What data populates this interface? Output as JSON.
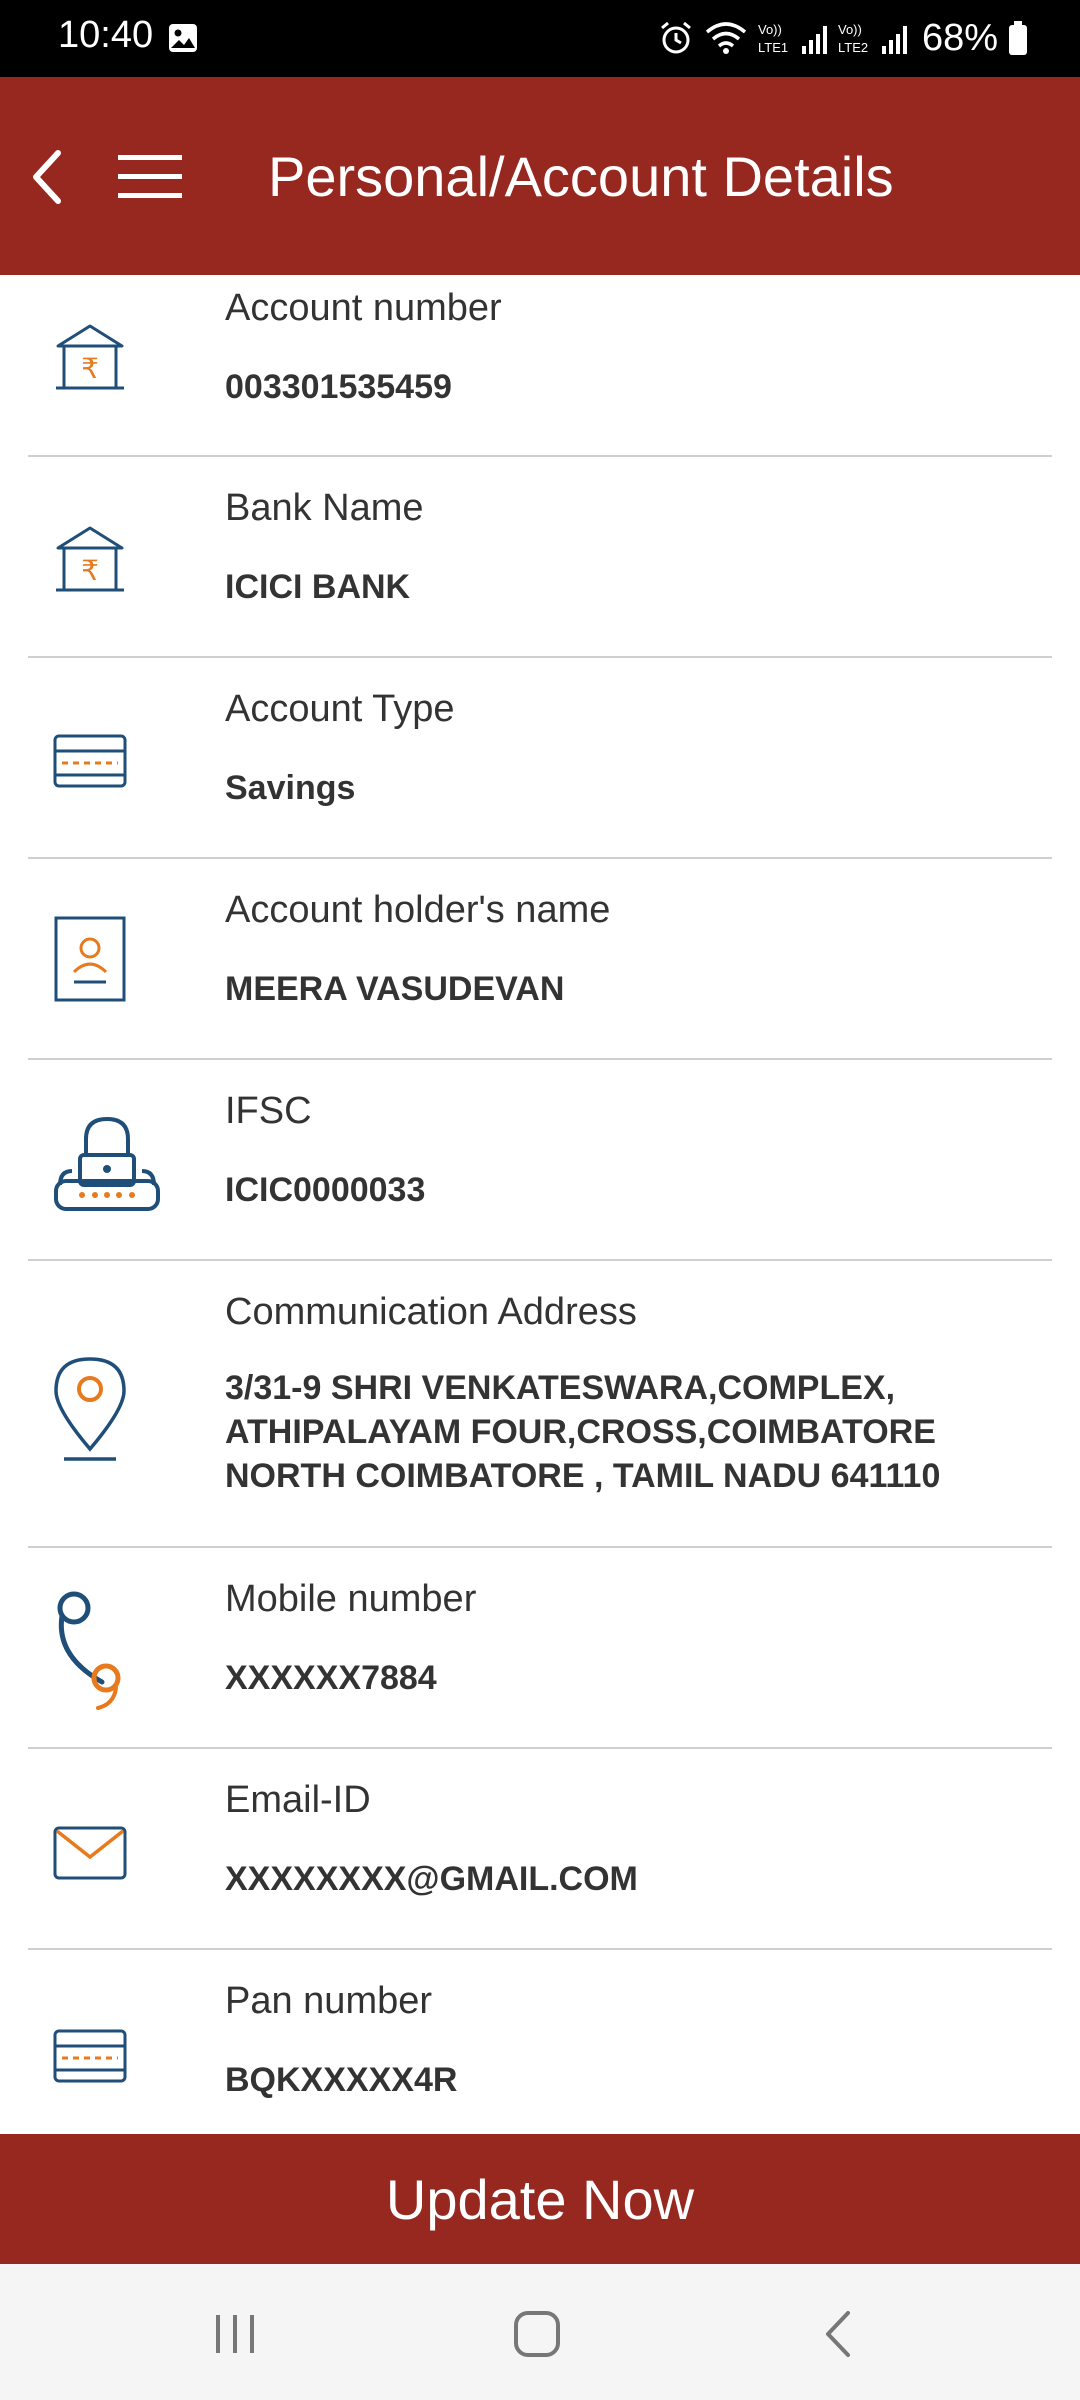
{
  "status_bar": {
    "time": "10:40",
    "battery": "68%",
    "sim1": "LTE1",
    "sim2": "LTE2"
  },
  "app_bar": {
    "title": "Personal/Account Details"
  },
  "details": [
    {
      "icon": "bank-icon",
      "label": "Account number",
      "value": "003301535459"
    },
    {
      "icon": "bank-icon",
      "label": "Bank Name",
      "value": "ICICI BANK"
    },
    {
      "icon": "card-icon",
      "label": "Account Type",
      "value": "Savings"
    },
    {
      "icon": "id-card-icon",
      "label": "Account holder's name",
      "value": "MEERA VASUDEVAN"
    },
    {
      "icon": "lock-icon",
      "label": "IFSC",
      "value": "ICIC0000033"
    },
    {
      "icon": "location-pin-icon",
      "label": "Communication Address",
      "value": "3/31-9 SHRI VENKATESWARA,COMPLEX, ATHIPALAYAM FOUR,CROSS,COIMBATORE NORTH COIMBATORE , TAMIL NADU 641110"
    },
    {
      "icon": "phone-icon",
      "label": "Mobile number",
      "value": "XXXXXX7884"
    },
    {
      "icon": "mail-icon",
      "label": "Email-ID",
      "value": "XXXXXXXX@GMAIL.COM"
    },
    {
      "icon": "card-icon",
      "label": "Pan number",
      "value": "BQKXXXXX4R"
    }
  ],
  "actions": {
    "update_label": "Update Now"
  },
  "colors": {
    "brand": "#972820",
    "icon_blue": "#1f4e79",
    "icon_orange": "#e87a1e"
  }
}
